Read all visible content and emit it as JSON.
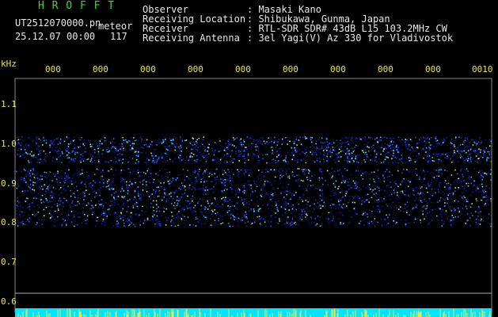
{
  "header": {
    "program": "H R O F F T",
    "filename": "UT2512070000.pn",
    "meteor_label": "meteor",
    "datetime": "25.12.07 00:00",
    "meteor_count": "117"
  },
  "info": {
    "observer_label": "Observer",
    "observer_value": ": Masaki Kano",
    "location_label": "Receiving Location",
    "location_value": ": Shibukawa, Gunma, Japan",
    "receiver_label": "Receiver",
    "receiver_value": ": RTL-SDR SDR# 43dB L15 103.2MHz CW",
    "antenna_label": "Receiving Antenna",
    "antenna_value": ": 3el Yagi(V) Az 330 for Vladivostok"
  },
  "axis": {
    "unit": "kHz",
    "y_ticks": [
      "1.1",
      "1.0",
      "0.9",
      "0.8",
      "0.7",
      "0.6"
    ],
    "x_ticks": [
      "000",
      "000",
      "000",
      "000",
      "000",
      "000",
      "000",
      "000",
      "000",
      "0010"
    ]
  },
  "colors": {
    "accent_green": "#33dd33",
    "label_yellow": "#e8e84a",
    "spectrum_blue": "#1e3cff",
    "bottom_bar_cyan": "#00e5ff"
  }
}
